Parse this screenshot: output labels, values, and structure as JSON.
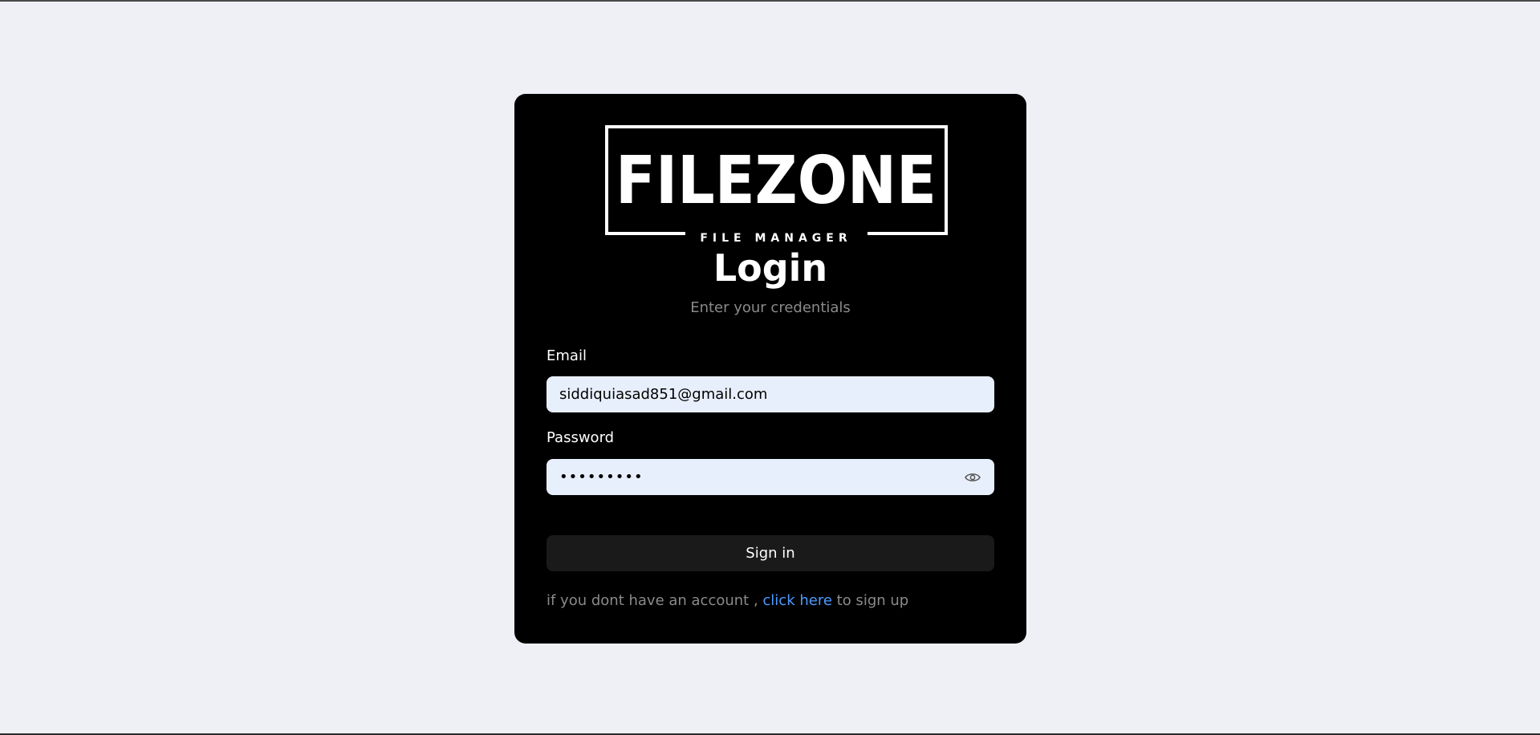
{
  "logo": {
    "text": "FILEZONE",
    "tagline": "FILE MANAGER"
  },
  "login": {
    "title": "Login",
    "subtitle": "Enter your credentials"
  },
  "form": {
    "email_label": "Email",
    "email_value": "siddiquiasad851@gmail.com",
    "password_label": "Password",
    "password_masked": "•••••••••",
    "password_toggle_icon": "eye-icon",
    "submit_label": "Sign in"
  },
  "signup": {
    "prefix": "if you dont have an account , ",
    "link_text": "click here",
    "suffix": " to sign up"
  },
  "colors": {
    "page_background": "#eef0f5",
    "card_background": "#000000",
    "input_background": "#e8effc",
    "button_background": "#1a1a1a",
    "link": "#4d9bff",
    "muted_text": "#8a8a8a"
  }
}
